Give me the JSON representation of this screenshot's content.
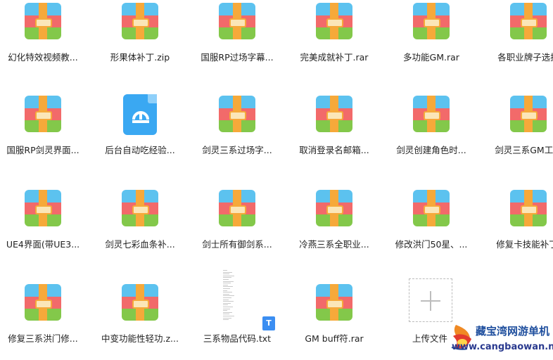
{
  "files": [
    {
      "name": "幻化特效视频教...",
      "type": "zip"
    },
    {
      "name": "形果体补丁.zip",
      "type": "zip"
    },
    {
      "name": "国服RP过场字幕...",
      "type": "zip"
    },
    {
      "name": "完美成就补丁.rar",
      "type": "zip"
    },
    {
      "name": "多功能GM.rar",
      "type": "zip"
    },
    {
      "name": "各职业牌子选择",
      "type": "zip"
    },
    {
      "name": "国服RP剑灵界面...",
      "type": "zip"
    },
    {
      "name": "后台自动吃经验...",
      "type": "doc"
    },
    {
      "name": "剑灵三系过场字...",
      "type": "zip"
    },
    {
      "name": "取消登录名邮箱...",
      "type": "zip"
    },
    {
      "name": "剑灵创建角色时...",
      "type": "zip"
    },
    {
      "name": "剑灵三系GM工具",
      "type": "zip"
    },
    {
      "name": "UE4界面(带UE3...",
      "type": "zip"
    },
    {
      "name": "剑灵七彩血条补...",
      "type": "zip"
    },
    {
      "name": "剑士所有御剑系...",
      "type": "zip"
    },
    {
      "name": "冷燕三系全职业...",
      "type": "zip"
    },
    {
      "name": "修改洪门50星、...",
      "type": "zip"
    },
    {
      "name": "修复卡技能补丁.",
      "type": "zip"
    },
    {
      "name": "修复三系洪门修...",
      "type": "zip"
    },
    {
      "name": "中变功能性轻功.z...",
      "type": "zip"
    },
    {
      "name": "三系物品代码.txt",
      "type": "txt"
    },
    {
      "name": "GM buff符.rar",
      "type": "zip"
    }
  ],
  "upload": {
    "label": "上传文件"
  },
  "txt_badge": "T",
  "watermark": {
    "title": "藏宝湾网游单机",
    "url": "www.cangbaowan.net"
  },
  "colors": {
    "zip_blue": "#5cc2ef",
    "zip_red": "#f26a6a",
    "zip_green": "#83c84a",
    "zip_strap": "#f6a93a",
    "doc_blue": "#3aa8f2"
  }
}
